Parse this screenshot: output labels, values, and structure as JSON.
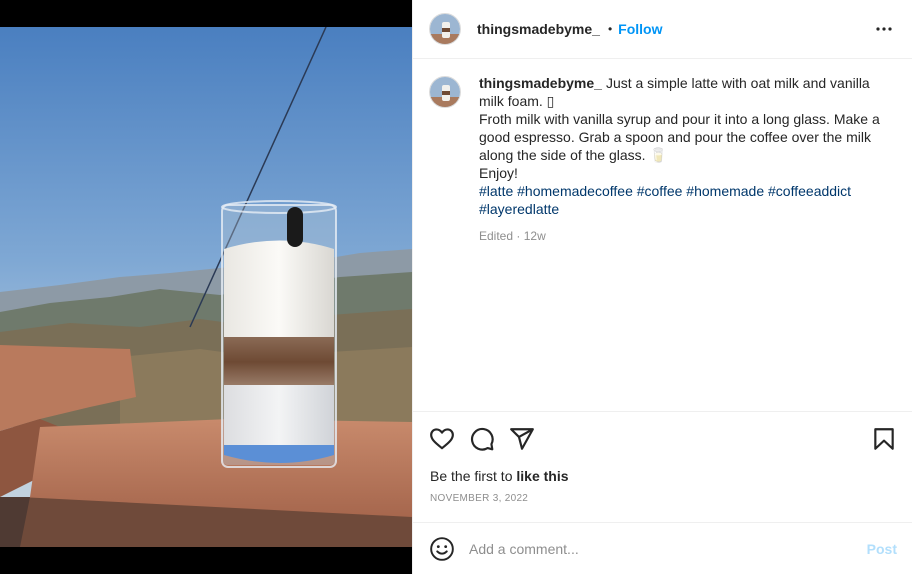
{
  "post": {
    "username": "thingsmadebyme_",
    "follow_label": "Follow",
    "separator": "•",
    "media_alt": "Layered latte in a tall glass on a terracotta wall with mountains and blue sky"
  },
  "caption": {
    "username": "thingsmadebyme_",
    "line1": "Just a simple latte with oat milk and vanilla milk foam. ▯",
    "line2": "Froth milk with vanilla syrup and pour it into a long glass. Make a good espresso. Grab a spoon and pour the coffee over the milk along the side of the glass. 🥛",
    "line3": "Enjoy!",
    "hashtags": "#latte #homemadecoffee #coffee #homemade #coffeeaddict #layeredlatte",
    "edited": "Edited",
    "meta_separator": "·",
    "age": "12w"
  },
  "actions": {
    "like_icon": "heart-icon",
    "comment_icon": "comment-icon",
    "share_icon": "paper-plane-icon",
    "save_icon": "bookmark-icon"
  },
  "likes": {
    "prefix": "Be the first to",
    "link": "like this"
  },
  "date": "NOVEMBER 3, 2022",
  "comment_box": {
    "placeholder": "Add a comment...",
    "post_label": "Post",
    "emoji_icon": "smiley-icon"
  },
  "colors": {
    "follow": "#0095f6",
    "hashtag": "#00376b",
    "post_disabled": "#b2dffc",
    "muted": "#8e8e8e"
  }
}
